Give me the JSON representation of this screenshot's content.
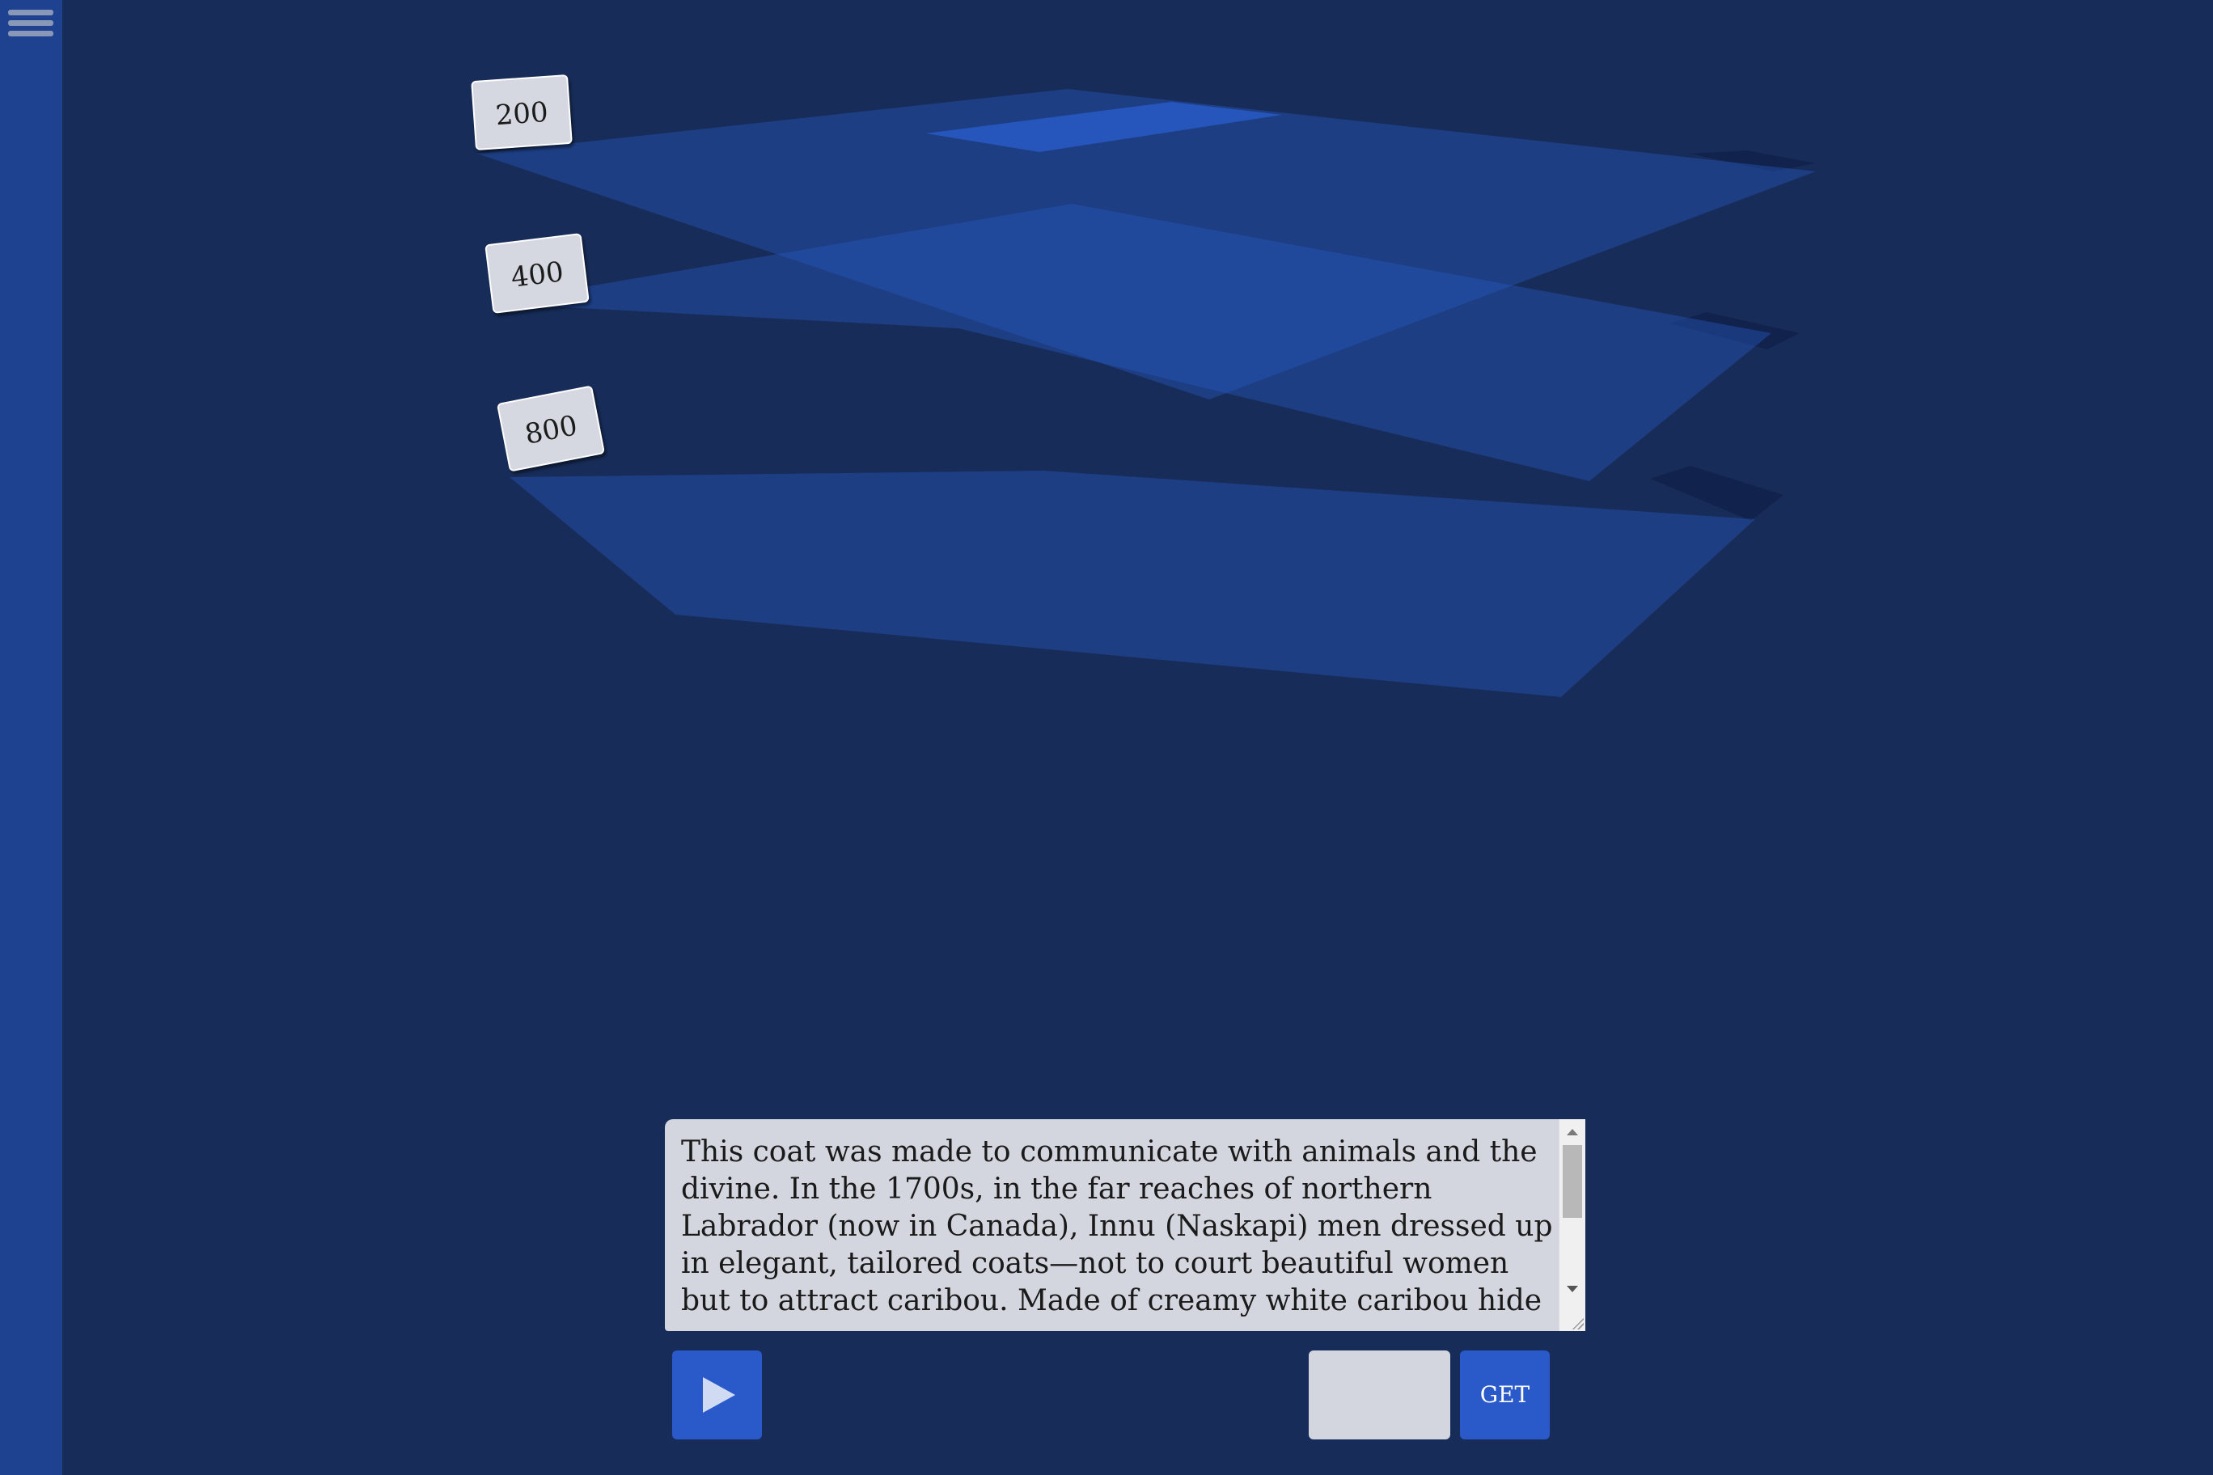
{
  "menu": {
    "icon": "hamburger-menu-icon"
  },
  "levels": [
    {
      "label": "200"
    },
    {
      "label": "400"
    },
    {
      "label": "800"
    }
  ],
  "description": {
    "text": "This coat was made to communicate with animals and the divine. In the 1700s, in the far reaches of northern Labrador (now in Canada), Innu (Naskapi) men dressed up in elegant, tailored coats—not to court beautiful women but to attract caribou. Made of creamy white caribou hide"
  },
  "controls": {
    "play_icon": "play-icon",
    "code_value": "",
    "get_label": "GET"
  },
  "colors": {
    "background": "#172c58",
    "sidebar": "#1e428f",
    "accent": "#2a5ac9",
    "plane": "#2555b8"
  }
}
